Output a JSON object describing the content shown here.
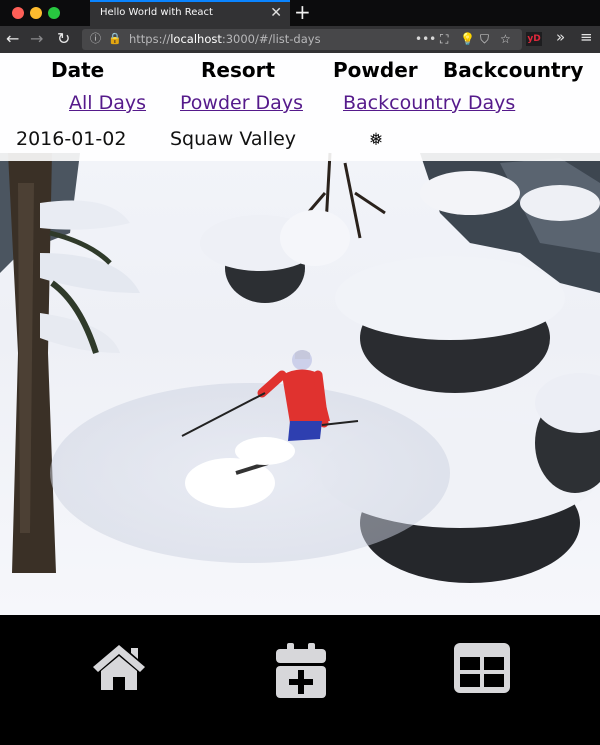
{
  "browser": {
    "tab_title": "Hello World with React",
    "tab_close_icon": "close-icon",
    "new_tab_icon": "plus-icon",
    "url_scheme": "https://",
    "url_host": "localhost",
    "url_rest": ":3000/#/list-days",
    "extension_label": "yD"
  },
  "table": {
    "headers": {
      "date": "Date",
      "resort": "Resort",
      "powder": "Powder",
      "backcountry": "Backcountry"
    },
    "filters": {
      "all": "All Days",
      "powder": "Powder Days",
      "backcountry": "Backcountry Days"
    },
    "rows": [
      {
        "date": "2016-01-02",
        "resort": "Squaw Valley",
        "powder": true,
        "backcountry": false,
        "powder_icon": "snowflake-icon"
      }
    ]
  },
  "bottom_nav": {
    "items": [
      {
        "icon": "home-icon"
      },
      {
        "icon": "calendar-add-icon"
      },
      {
        "icon": "table-icon"
      }
    ],
    "icon_color": "#d7d7da"
  },
  "colors": {
    "link": "#551a8b",
    "tab_accent": "#0a84ff",
    "chrome": "#323234"
  }
}
